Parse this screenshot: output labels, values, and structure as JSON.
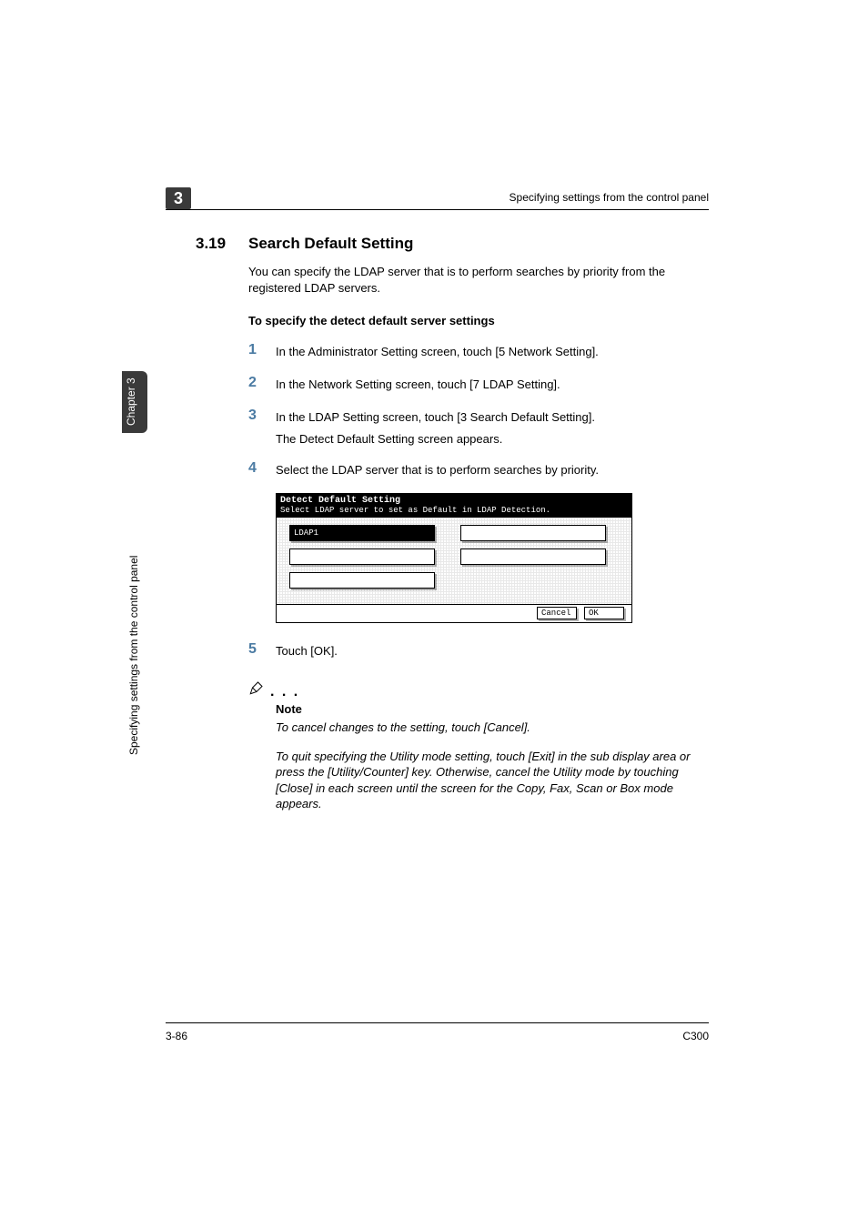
{
  "side": {
    "chapter_label": "Chapter 3",
    "vertical_text": "Specifying settings from the control panel"
  },
  "header": {
    "chapter_num": "3",
    "right_text": "Specifying settings from the control panel"
  },
  "section": {
    "number": "3.19",
    "title": "Search Default Setting",
    "intro": "You can specify the LDAP server that is to perform searches by priority from the registered LDAP servers.",
    "subhead": "To specify the detect default server settings"
  },
  "steps": {
    "s1": {
      "num": "1",
      "text": "In the Administrator Setting screen, touch [5 Network Setting]."
    },
    "s2": {
      "num": "2",
      "text": "In the Network Setting screen, touch [7 LDAP Setting]."
    },
    "s3": {
      "num": "3",
      "text": "In the LDAP Setting screen, touch [3 Search Default Setting].",
      "sub": "The Detect Default Setting screen appears."
    },
    "s4": {
      "num": "4",
      "text": "Select the LDAP server that is to perform searches by priority."
    },
    "s5": {
      "num": "5",
      "text": "Touch [OK]."
    }
  },
  "screenshot": {
    "title": "Detect Default Setting",
    "subtitle": "Select LDAP server to set as Default in LDAP Detection.",
    "item1": "LDAP1",
    "cancel": "Cancel",
    "ok": "OK"
  },
  "note": {
    "title": "Note",
    "p1": "To cancel changes to the setting, touch [Cancel].",
    "p2": "To quit specifying the Utility mode setting, touch [Exit] in the sub display area or press the [Utility/Counter] key. Otherwise, cancel the Utility mode by touching [Close] in each screen until the screen for the Copy, Fax, Scan or Box mode appears."
  },
  "footer": {
    "left": "3-86",
    "right": "C300"
  }
}
